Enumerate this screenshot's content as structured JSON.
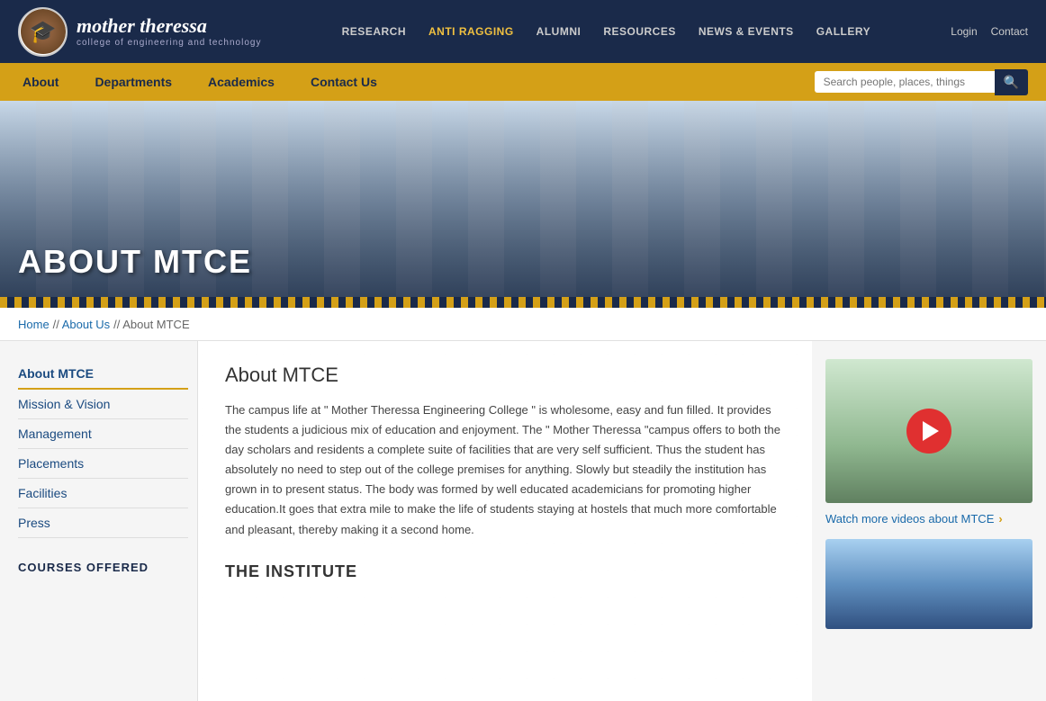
{
  "logo": {
    "name": "mother theressa",
    "tagline": "college of engineering and technology",
    "icon": "🎓"
  },
  "top_nav": {
    "items": [
      {
        "label": "RESEARCH",
        "href": "#"
      },
      {
        "label": "ANTI RAGGING",
        "href": "#",
        "active": true
      },
      {
        "label": "ALUMNI",
        "href": "#"
      },
      {
        "label": "RESOURCES",
        "href": "#"
      },
      {
        "label": "NEWS & EVENTS",
        "href": "#"
      },
      {
        "label": "GALLERY",
        "href": "#"
      }
    ],
    "right": {
      "login": "Login",
      "contact": "Contact"
    }
  },
  "main_nav": {
    "items": [
      {
        "label": "About",
        "href": "#"
      },
      {
        "label": "Departments",
        "href": "#"
      },
      {
        "label": "Academics",
        "href": "#"
      },
      {
        "label": "Contact Us",
        "href": "#"
      }
    ],
    "search_placeholder": "Search people, places, things"
  },
  "hero": {
    "title": "ABOUT MTCE"
  },
  "breadcrumb": {
    "home": "Home",
    "separator1": "//",
    "about_us": "About Us",
    "separator2": "//",
    "current": "About MTCE"
  },
  "sidebar": {
    "menu": [
      {
        "label": "About MTCE",
        "active": true
      },
      {
        "label": "Mission & Vision"
      },
      {
        "label": "Management"
      },
      {
        "label": "Placements"
      },
      {
        "label": "Facilities"
      },
      {
        "label": "Press"
      }
    ],
    "courses_header": "COURSES OFFERED"
  },
  "main": {
    "page_title": "About MTCE",
    "body_text": "The campus life at \" Mother Theressa Engineering College \" is wholesome, easy and fun filled. It provides the students a judicious mix of education and enjoyment. The \" Mother Theressa \"campus offers to both the day scholars and residents a complete suite of facilities that are very self sufficient. Thus the student has absolutely no need to step out of the college premises for anything. Slowly but steadily the institution has grown in to present status. The body was formed by well educated academicians for promoting higher education.It goes that extra mile to make the life of students staying at hostels that much more comfortable and pleasant, thereby making it a second home.",
    "section_title": "THE INSTITUTE"
  },
  "right_sidebar": {
    "video_link": "Watch more videos about MTCE"
  }
}
